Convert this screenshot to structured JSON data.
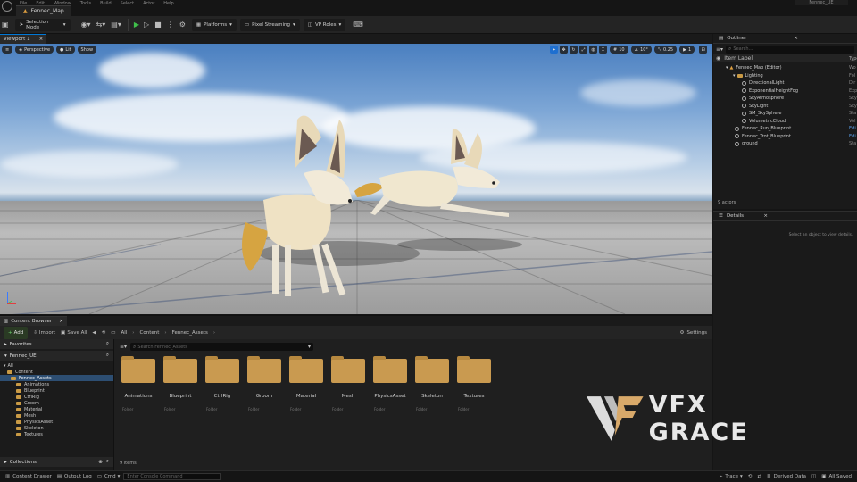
{
  "menu": [
    "File",
    "Edit",
    "Window",
    "Tools",
    "Build",
    "Select",
    "Actor",
    "Help"
  ],
  "level_tab": "Fennec_Map",
  "window_title": "Fennec_UE",
  "toolbar": {
    "selection_mode": "Selection Mode",
    "platforms": "Platforms",
    "pixel_streaming": "Pixel Streaming",
    "vp_roles": "VP Roles"
  },
  "viewport": {
    "tab": "Viewport 1",
    "perspective": "Perspective",
    "lit": "Lit",
    "show": "Show",
    "grid_snap": "10",
    "rot_snap": "10°",
    "scale_snap": "0.25",
    "cam_speed": "1"
  },
  "outliner": {
    "tab": "Outliner",
    "search_placeholder": "Search...",
    "col_label": "Item Label",
    "col_type": "Type",
    "rows": [
      {
        "label": "Fennec_Map (Editor)",
        "type": "Wo"
      },
      {
        "label": "Lighting",
        "type": "Fol"
      },
      {
        "label": "DirectionalLight",
        "type": "Dir"
      },
      {
        "label": "ExponentialHeightFog",
        "type": "Exp"
      },
      {
        "label": "SkyAtmosphere",
        "type": "Sky"
      },
      {
        "label": "SkyLight",
        "type": "Sky"
      },
      {
        "label": "SM_SkySphere",
        "type": "Sta"
      },
      {
        "label": "VolumetricCloud",
        "type": "Vol"
      },
      {
        "label": "Fennec_Run_Blueprint",
        "type": "Edi"
      },
      {
        "label": "Fennec_Trot_Blueprint",
        "type": "Edi"
      },
      {
        "label": "ground",
        "type": "Sta"
      }
    ],
    "count": "9 actors"
  },
  "details": {
    "tab": "Details",
    "empty": "Select an object to view details."
  },
  "content_browser": {
    "tab": "Content Browser",
    "add": "Add",
    "import": "Import",
    "save_all": "Save All",
    "crumbs": [
      "All",
      "Content",
      "Fennec_Assets"
    ],
    "settings": "Settings",
    "favorites": "Favorites",
    "project": "Fennec_UE",
    "search_placeholder": "Search Fennec_Assets",
    "tree": [
      "All",
      "Content",
      "Fennec_Assets",
      "Animations",
      "Blueprint",
      "CtrlRig",
      "Groom",
      "Material",
      "Mesh",
      "PhysicsAsset",
      "Skeleton",
      "Textures"
    ],
    "folders": [
      "Animations",
      "Blueprint",
      "CtrlRig",
      "Groom",
      "Material",
      "Mesh",
      "PhysicsAsset",
      "Skeleton",
      "Textures"
    ],
    "folder_type": "Folder",
    "collections": "Collections",
    "item_count": "9 items"
  },
  "status": {
    "content_drawer": "Content Drawer",
    "output_log": "Output Log",
    "cmd": "Cmd",
    "console_placeholder": "Enter Console Command",
    "trace": "Trace",
    "derived_data": "Derived Data",
    "saved": "All Saved"
  },
  "watermark": "VFX GRACE",
  "colors": {
    "accent": "#0078d7",
    "folder": "#c99a50",
    "play": "#3fbf4a",
    "selection": "#2d4e72"
  }
}
